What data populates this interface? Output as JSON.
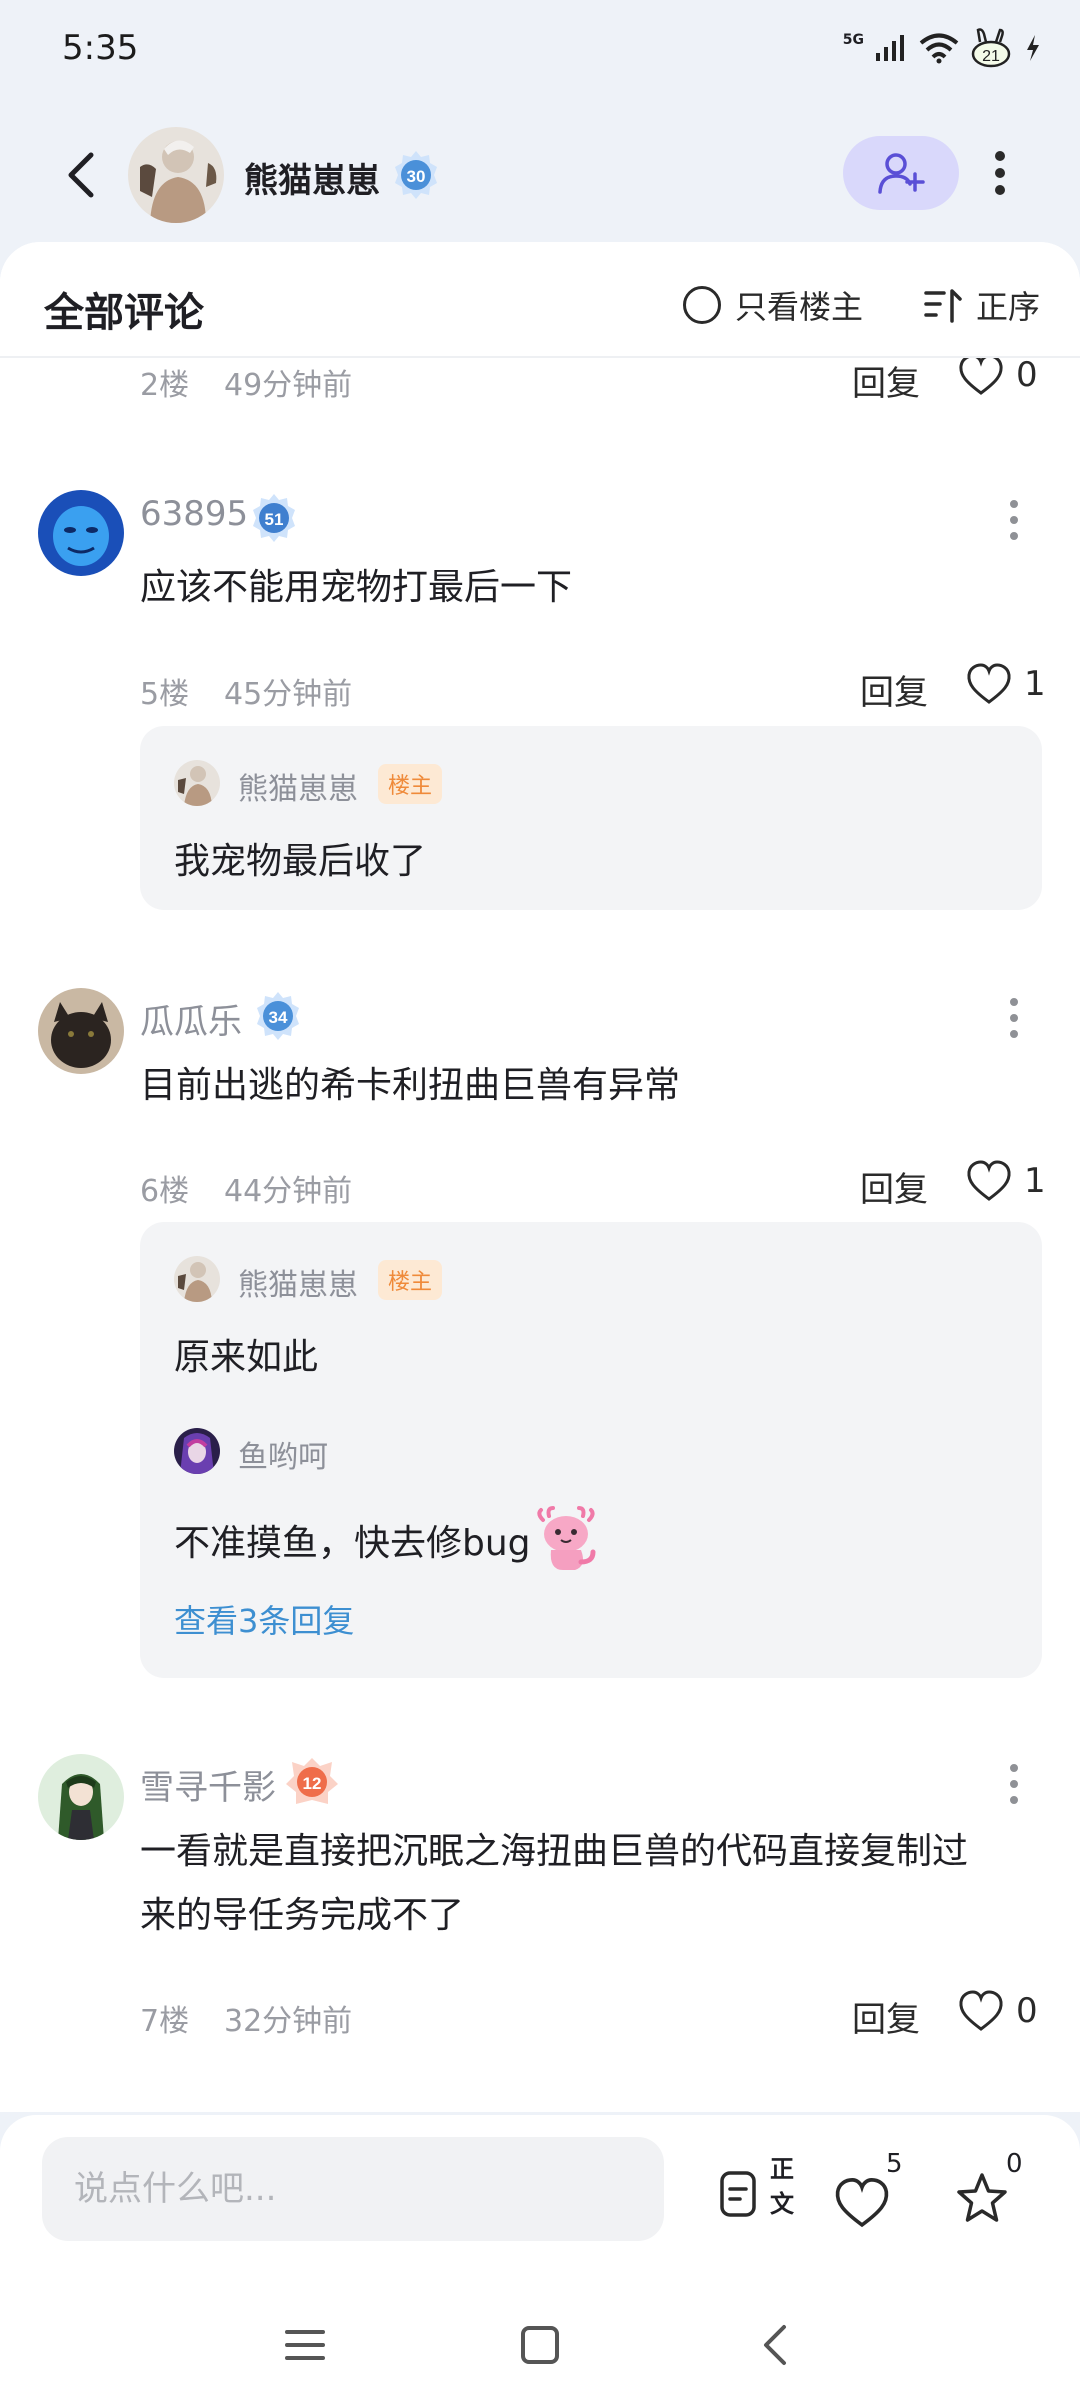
{
  "status_bar": {
    "time": "5:35",
    "network": "5G",
    "battery": "21"
  },
  "header": {
    "username": "熊猫崽崽",
    "level": "30"
  },
  "panel": {
    "title": "全部评论",
    "only_op_label": "只看楼主",
    "sort_label": "正序"
  },
  "labels": {
    "reply": "回复",
    "op_tag": "楼主"
  },
  "top_meta": {
    "floor": "2楼",
    "time": "49分钟前",
    "likes": "0"
  },
  "comments": [
    {
      "name": "63895",
      "level": "51",
      "text": "应该不能用宠物打最后一下",
      "floor": "5楼",
      "time": "45分钟前",
      "likes": "1",
      "replies": [
        {
          "name": "熊猫崽崽",
          "text": "我宠物最后收了"
        }
      ]
    },
    {
      "name": "瓜瓜乐",
      "level": "34",
      "text": "目前出逃的希卡利扭曲巨兽有异常",
      "floor": "6楼",
      "time": "44分钟前",
      "likes": "1",
      "replies": [
        {
          "name": "熊猫崽崽",
          "text": "原来如此"
        },
        {
          "name": "鱼哟呵",
          "text": "不准摸鱼，快去修bug"
        }
      ],
      "view_more": "查看3条回复"
    },
    {
      "name": "雪寻千影",
      "level": "12",
      "text_line1": "一看就是直接把沉眠之海扭曲巨兽的代码直接复制过",
      "text_line2": "来的导任务完成不了",
      "floor": "7楼",
      "time": "32分钟前",
      "likes": "0"
    }
  ],
  "bottom": {
    "input_placeholder": "说点什么吧...",
    "body_label": "正文",
    "like_count": "5",
    "star_count": "0"
  },
  "colors": {
    "accent": "#3d8fd1",
    "follow_bg": "#d9d8fb",
    "op_tag": "#ef8a3a"
  }
}
